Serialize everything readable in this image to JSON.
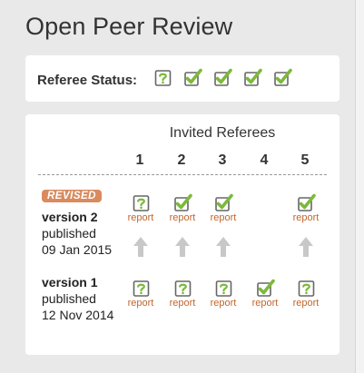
{
  "title": "Open Peer Review",
  "status": {
    "label": "Referee Status:",
    "icons": [
      "question",
      "approved",
      "approved",
      "approved",
      "approved"
    ]
  },
  "referees": {
    "heading": "Invited Referees",
    "numbers": [
      "1",
      "2",
      "3",
      "4",
      "5"
    ],
    "revised_badge": "REVISED",
    "versions": [
      {
        "name": "version 2",
        "line2": "published",
        "date": "09 Jan 2015",
        "reports": [
          "question",
          "approved",
          "approved",
          "",
          "approved"
        ],
        "report_label": "report"
      },
      {
        "name": "version 1",
        "line2": "published",
        "date": "12 Nov 2014",
        "reports": [
          "question",
          "question",
          "question",
          "approved",
          "question"
        ],
        "report_label": "report"
      }
    ]
  },
  "colors": {
    "check": "#7cb93b",
    "report_link": "#c1662b",
    "badge": "#d98b5f",
    "arrow": "#c8c8c8"
  }
}
